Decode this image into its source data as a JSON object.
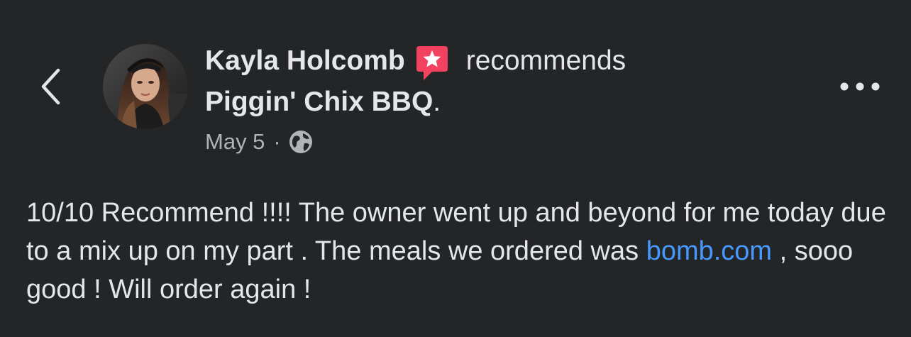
{
  "header": {
    "back_icon": "chevron-left-icon",
    "more_icon": "more-horizontal-icon"
  },
  "post": {
    "author_name": "Kayla Holcomb",
    "recommend_badge_icon": "recommend-star-icon",
    "badge_color": "#f3425f",
    "verb": "recommends",
    "page_name": "Piggin' Chix BBQ",
    "page_name_suffix": ".",
    "date": "May 5",
    "separator": "·",
    "audience_icon": "globe-icon",
    "body_part1": "10/10 Recommend !!!! The owner went up and beyond for me today due to a mix up on my part . The meals we ordered was ",
    "body_link": "bomb.com",
    "body_part2": " , sooo good ! Will order again !",
    "link_color": "#4599ff"
  },
  "colors": {
    "background": "#242526",
    "primary_text": "#e4e6eb",
    "secondary_text": "#b0b3b8"
  }
}
